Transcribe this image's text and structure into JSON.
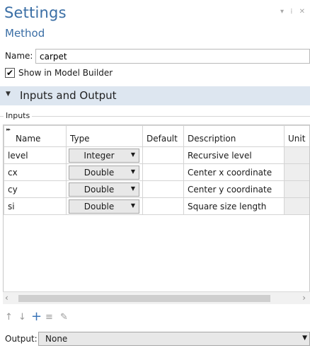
{
  "window": {
    "title": "Settings",
    "subtitle": "Method",
    "controls": "▾ ✕"
  },
  "name_field": {
    "label": "Name:",
    "value": "carpet"
  },
  "show_in_builder": {
    "label": "Show in Model Builder",
    "checked": true
  },
  "section": {
    "label": "Inputs and Output"
  },
  "inputs_group": {
    "label": "Inputs"
  },
  "table": {
    "columns": [
      "Name",
      "Type",
      "Default",
      "Description",
      "Unit"
    ],
    "rows": [
      {
        "name": "level",
        "type": "Integer",
        "default": "",
        "description": "Recursive level",
        "unit": ""
      },
      {
        "name": "cx",
        "type": "Double",
        "default": "",
        "description": "Center x coordinate",
        "unit": ""
      },
      {
        "name": "cy",
        "type": "Double",
        "default": "",
        "description": "Center y coordinate",
        "unit": ""
      },
      {
        "name": "si",
        "type": "Double",
        "default": "",
        "description": "Square size length",
        "unit": ""
      }
    ]
  },
  "toolbar": {
    "icons": [
      "arrow-up-icon",
      "arrow-down-icon",
      "add-icon",
      "delete-icon",
      "edit-icon"
    ]
  },
  "output": {
    "label": "Output:",
    "value": "None"
  }
}
